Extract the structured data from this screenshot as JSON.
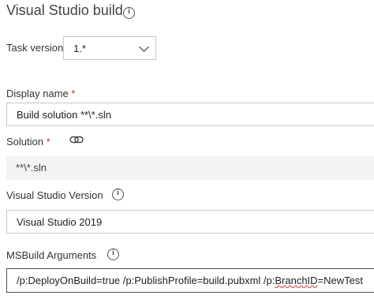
{
  "header": {
    "title": "Visual Studio build"
  },
  "task_version": {
    "label": "Task version",
    "value": "1.*"
  },
  "display_name": {
    "label": "Display name",
    "required": "*",
    "value": "Build solution **\\*.sln"
  },
  "solution": {
    "label": "Solution",
    "required": "*",
    "value": "**\\*.sln"
  },
  "vs_version": {
    "label": "Visual Studio Version",
    "value": "Visual Studio 2019"
  },
  "msbuild": {
    "label": "MSBuild Arguments",
    "value_prefix": "/p:DeployOnBuild=true /p:PublishProfile=build.pubxml /p:",
    "value_misspelled": "BranchID",
    "value_suffix": "=NewTest"
  },
  "icons": [
    "info-icon",
    "link-icon",
    "chevron-down-icon"
  ]
}
